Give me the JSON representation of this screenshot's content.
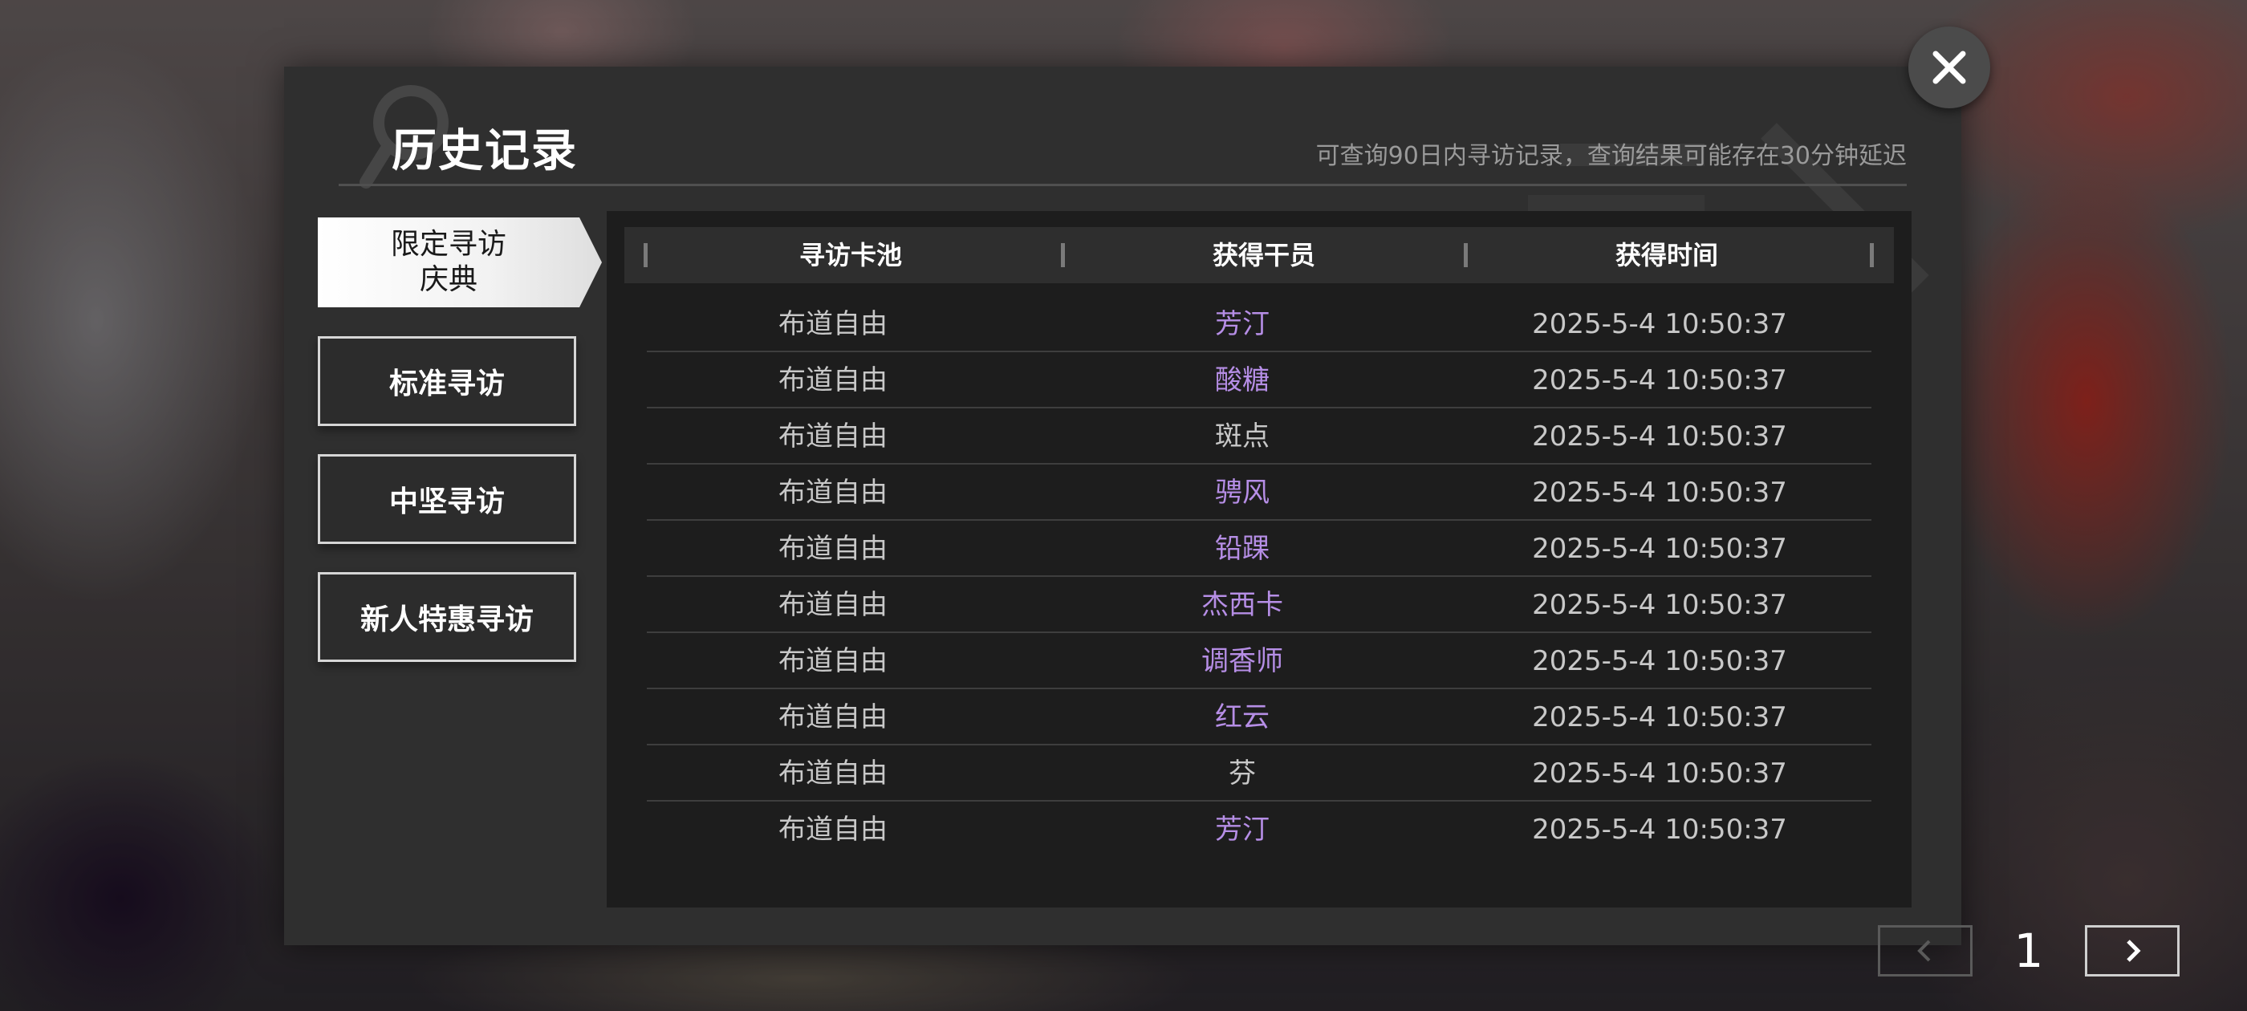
{
  "modal": {
    "title": "历史记录",
    "subtitle": "可查询90日内寻访记录，查询结果可能存在30分钟延迟"
  },
  "tabs": [
    {
      "label": "限定寻访\n庆典",
      "active": true
    },
    {
      "label": "标准寻访",
      "active": false
    },
    {
      "label": "中坚寻访",
      "active": false
    },
    {
      "label": "新人特惠寻访",
      "active": false
    }
  ],
  "table": {
    "headers": [
      "寻访卡池",
      "获得干员",
      "获得时间"
    ],
    "rows": [
      {
        "pool": "布道自由",
        "operator": "芳汀",
        "time": "2025-5-4 10:50:37",
        "highlight": true
      },
      {
        "pool": "布道自由",
        "operator": "酸糖",
        "time": "2025-5-4 10:50:37",
        "highlight": true
      },
      {
        "pool": "布道自由",
        "operator": "斑点",
        "time": "2025-5-4 10:50:37",
        "highlight": false
      },
      {
        "pool": "布道自由",
        "operator": "骋风",
        "time": "2025-5-4 10:50:37",
        "highlight": true
      },
      {
        "pool": "布道自由",
        "operator": "铅踝",
        "time": "2025-5-4 10:50:37",
        "highlight": true
      },
      {
        "pool": "布道自由",
        "operator": "杰西卡",
        "time": "2025-5-4 10:50:37",
        "highlight": true
      },
      {
        "pool": "布道自由",
        "operator": "调香师",
        "time": "2025-5-4 10:50:37",
        "highlight": true
      },
      {
        "pool": "布道自由",
        "operator": "红云",
        "time": "2025-5-4 10:50:37",
        "highlight": true
      },
      {
        "pool": "布道自由",
        "operator": "芬",
        "time": "2025-5-4 10:50:37",
        "highlight": false
      },
      {
        "pool": "布道自由",
        "operator": "芳汀",
        "time": "2025-5-4 10:50:37",
        "highlight": true
      }
    ]
  },
  "pagination": {
    "current_page": "1"
  },
  "colors": {
    "highlight": "#b68ee6",
    "normal": "#c8c8c8",
    "panel": "#1d1d1d",
    "modal": "#2f2f2f"
  },
  "icons": {
    "close": "close-icon",
    "prev": "chevron-left-icon",
    "next": "chevron-right-icon",
    "title_deco": "magnifier-icon"
  }
}
